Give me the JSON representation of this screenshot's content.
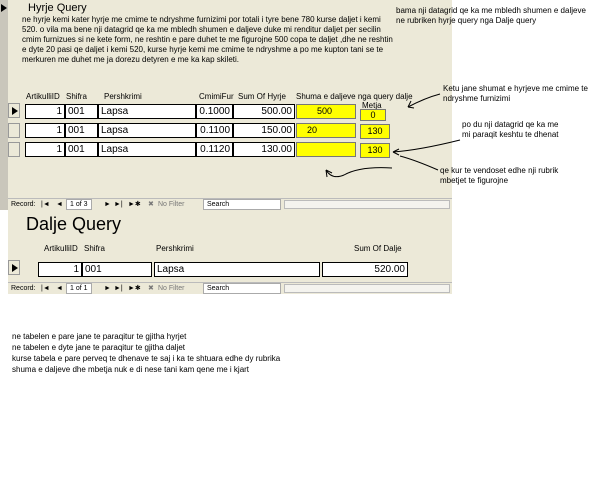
{
  "form1": {
    "title": "Hyrje Query",
    "note": "ne hyrje kemi kater hyrje me cmime te ndryshme furnizimi por totali i tyre bene 780 kurse daljet i kemi 520. o vila ma bene nji datagrid qe ka me mbledh shumen e daljeve duke mi renditur daljet per secilin cmim furnizues si ne kete form, ne reshtin e pare duhet te me figurojne 500 copa te daljet ,dhe ne reshtin e dyte 20 pasi qe daljet i kemi 520, kurse hyrje kemi me cmime te ndryshme a po me kupton tani se te merkuren me duhet me ja dorezu detyren e me ka kap skileti.",
    "headers": [
      "ArtikulliID",
      "Shifra",
      "Pershkrimi",
      "CmimiFur",
      "Sum Of Hyrje",
      "Shuma e daljeve nga query dalje",
      "Metja"
    ],
    "rows": [
      {
        "id": "1",
        "shifra": "001",
        "pershkrimi": "Lapsa",
        "cmimi": "0.1000",
        "sum": "500.00",
        "shuma": "500",
        "metja": "0"
      },
      {
        "id": "1",
        "shifra": "001",
        "pershkrimi": "Lapsa",
        "cmimi": "0.1100",
        "sum": "150.00",
        "shuma": "20",
        "metja": "130"
      },
      {
        "id": "1",
        "shifra": "001",
        "pershkrimi": "Lapsa",
        "cmimi": "0.1120",
        "sum": "130.00",
        "shuma": "",
        "metja": "130"
      }
    ],
    "nav": {
      "record_label": "Record:",
      "position": "1 of 3",
      "filter": "No Filter",
      "search": "Search"
    }
  },
  "form2": {
    "title": "Dalje Query",
    "headers": [
      "ArtikulliID",
      "Shifra",
      "Pershkrimi",
      "Sum Of Dalje"
    ],
    "row": {
      "id": "1",
      "shifra": "001",
      "pershkrimi": "Lapsa",
      "sum": "520.00"
    },
    "nav": {
      "record_label": "Record:",
      "position": "1 of 1",
      "filter": "No Filter",
      "search": "Search"
    }
  },
  "annotations": {
    "top_right": "bama nji datagrid qe ka me mbledh shumen e daljeve ne rubriken hyrje query nga Dalje query",
    "sum_note": "Ketu jane shumat e hyrjeve me cmime te ndryshme furnizimi",
    "datagrid_note": "po du nji datagrid qe ka me mi paraqit keshtu te dhenat",
    "subtract_note": "qe kur te vendoset edhe nji rubrik mbetjet te figurojne"
  },
  "bottom_text": [
    "ne tabelen e pare jane te paraqitur te gjitha hyrjet",
    "ne tabelen e dyte jane te paraqitur te gjitha daljet",
    " kurse tabela e pare perveq te dhenave te saj i ka te shtuara edhe dy rubrika",
    "shuma e daljeve dhe mbetja nuk e di nese tani kam qene me i kjart"
  ]
}
